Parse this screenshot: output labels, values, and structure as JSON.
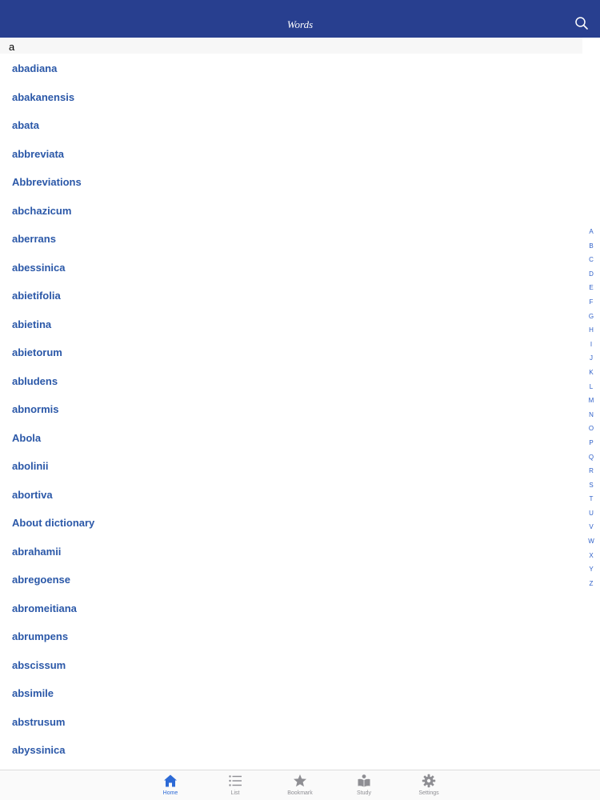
{
  "colors": {
    "navbar": "#283f8f",
    "word_text": "#2b58a8",
    "index_text": "#2d5fc8",
    "tab_active": "#2d6ad6",
    "tab_inactive": "#8e8e93"
  },
  "navbar": {
    "title": "Words",
    "search_icon": "search-icon"
  },
  "section": {
    "header": "a"
  },
  "words": [
    "abadiana",
    "abakanensis",
    "abata",
    "abbreviata",
    "Abbreviations",
    "abchazicum",
    "aberrans",
    "abessinica",
    "abietifolia",
    "abietina",
    "abietorum",
    "abludens",
    "abnormis",
    "Abola",
    "abolinii",
    "abortiva",
    "About dictionary",
    "abrahamii",
    "abregoense",
    "abromeitiana",
    "abrumpens",
    "abscissum",
    "absimile",
    "abstrusum",
    "abyssinica"
  ],
  "index": [
    "A",
    "B",
    "C",
    "D",
    "E",
    "F",
    "G",
    "H",
    "I",
    "J",
    "K",
    "L",
    "M",
    "N",
    "O",
    "P",
    "Q",
    "R",
    "S",
    "T",
    "U",
    "V",
    "W",
    "X",
    "Y",
    "Z"
  ],
  "tabs": [
    {
      "id": "home",
      "label": "Home",
      "icon": "home-icon",
      "active": true
    },
    {
      "id": "list",
      "label": "List",
      "icon": "list-icon",
      "active": false
    },
    {
      "id": "bookmark",
      "label": "Bookmark",
      "icon": "star-icon",
      "active": false
    },
    {
      "id": "study",
      "label": "Study",
      "icon": "study-icon",
      "active": false
    },
    {
      "id": "settings",
      "label": "Settings",
      "icon": "gear-icon",
      "active": false
    }
  ]
}
